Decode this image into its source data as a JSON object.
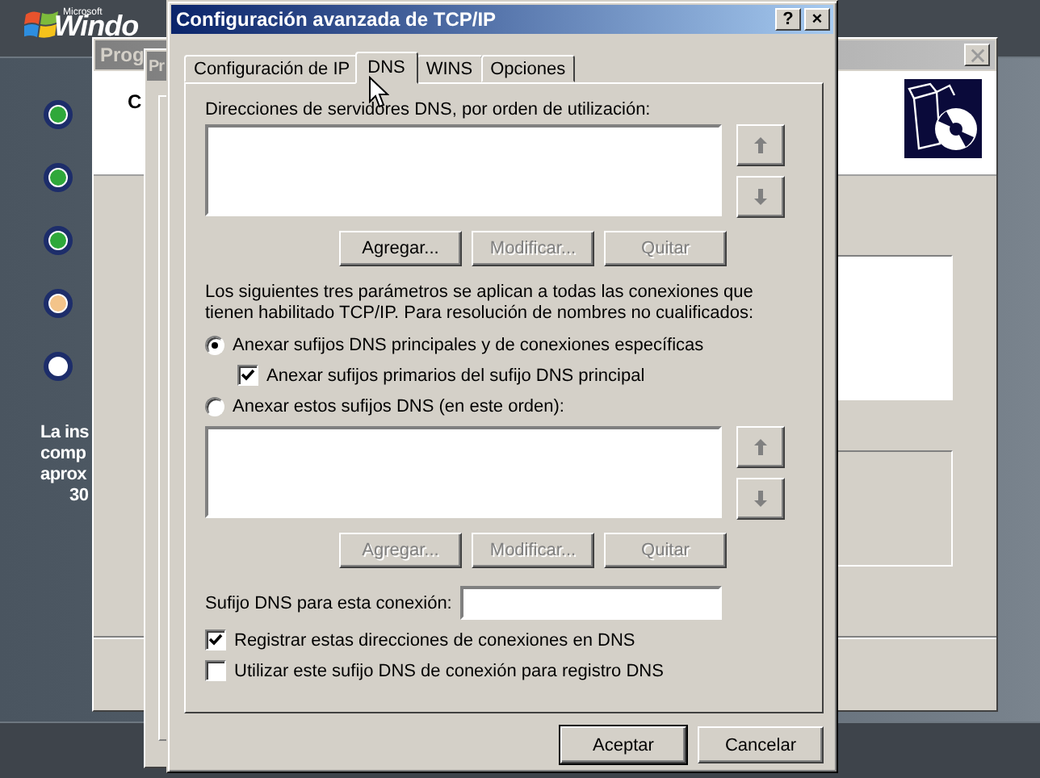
{
  "background": {
    "logo": {
      "small": "Microsoft",
      "name": "Windo"
    },
    "steps": [
      {
        "done": true,
        "current": false
      },
      {
        "done": true,
        "current": false
      },
      {
        "done": true,
        "current": false
      },
      {
        "done": false,
        "current": true
      },
      {
        "done": false,
        "current": false
      }
    ],
    "note_lines": [
      "La ins",
      "comp",
      "aprox",
      "30"
    ]
  },
  "back_windows": [
    {
      "title": "Prog",
      "header_text": "C"
    },
    {
      "title": "Pr"
    }
  ],
  "dialog": {
    "title": "Configuración avanzada de TCP/IP",
    "title_buttons": [
      "?",
      "×"
    ],
    "tabs": [
      {
        "label": "Configuración de IP",
        "selected": false
      },
      {
        "label": "DNS",
        "selected": true
      },
      {
        "label": "WINS",
        "selected": false
      },
      {
        "label": "Opciones",
        "selected": false
      }
    ],
    "servers_label": "Direcciones de servidores DNS, por orden de utilización:",
    "servers_move_buttons": [
      {
        "kind": "up",
        "disabled": true
      },
      {
        "kind": "down",
        "disabled": true
      }
    ],
    "servers_buttons": [
      {
        "label": "Agregar...",
        "disabled": false
      },
      {
        "label": "Modificar...",
        "disabled": true
      },
      {
        "label": "Quitar",
        "disabled": true
      }
    ],
    "options_text": "Los siguientes tres parámetros se aplican a todas las conexiones que tienen habilitado TCP/IP. Para resolución de nombres no cualificados:",
    "options": [
      {
        "kind": "radio",
        "label": "Anexar sufijos DNS principales y de conexiones específicas",
        "selected": true,
        "children": [
          {
            "kind": "checkbox",
            "label": "Anexar sufijos primarios del sufijo DNS principal",
            "checked": true
          }
        ]
      },
      {
        "kind": "radio",
        "label": "Anexar estos sufijos DNS (en este orden):",
        "selected": false
      }
    ],
    "suffix_move_buttons": [
      {
        "kind": "up",
        "disabled": true
      },
      {
        "kind": "down",
        "disabled": true
      }
    ],
    "suffix_buttons": [
      {
        "label": "Agregar...",
        "disabled": true
      },
      {
        "label": "Modificar...",
        "disabled": true
      },
      {
        "label": "Quitar",
        "disabled": true
      }
    ],
    "suffix_field": {
      "label": "Sufijo DNS para esta conexión:"
    },
    "checkboxes": [
      {
        "label": "Registrar estas direcciones de conexiones en DNS",
        "checked": true
      },
      {
        "label": "Utilizar este sufijo DNS de conexión para registro DNS",
        "checked": false
      }
    ],
    "footer_buttons": [
      {
        "label": "Aceptar",
        "default": true
      },
      {
        "label": "Cancelar",
        "default": false
      }
    ]
  }
}
